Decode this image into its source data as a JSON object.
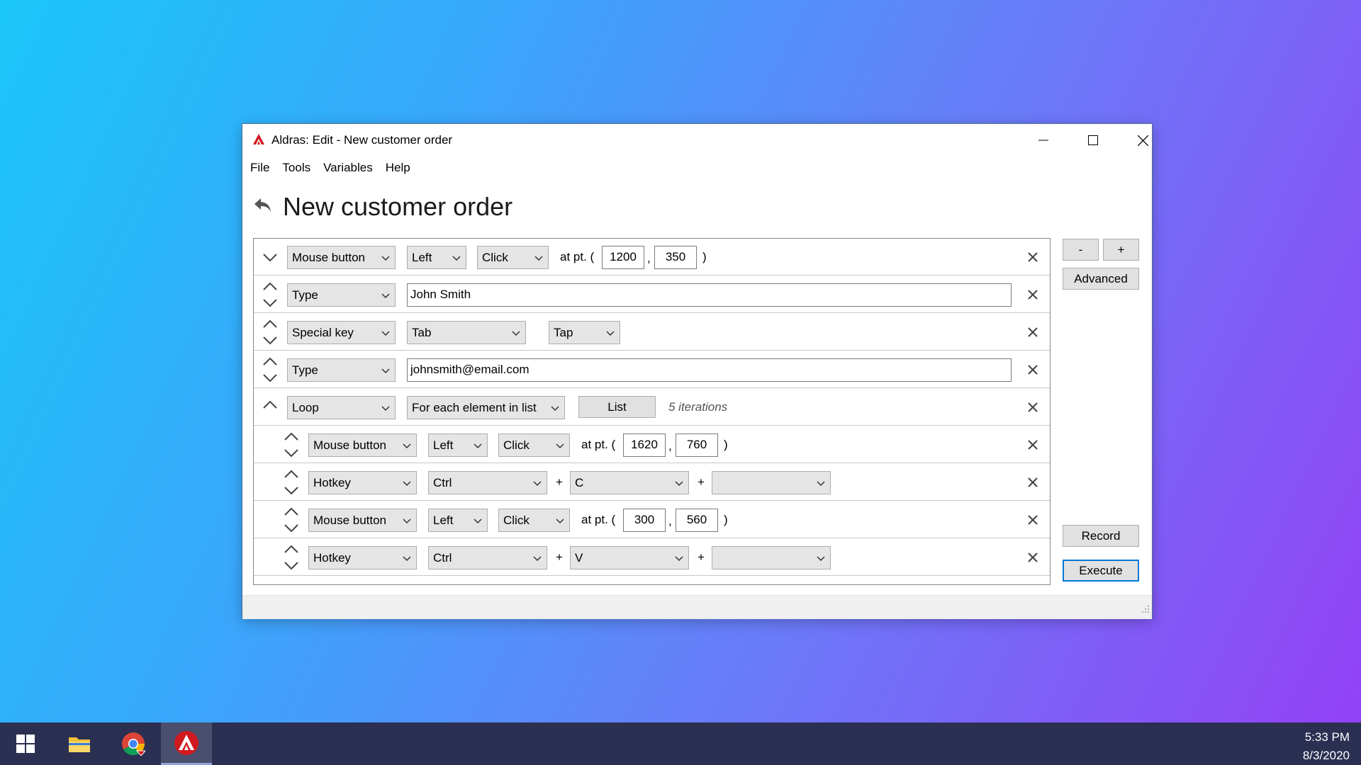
{
  "window": {
    "title": "Aldras: Edit - New customer order",
    "menu": [
      "File",
      "Tools",
      "Variables",
      "Help"
    ],
    "heading": "New customer order"
  },
  "rows": [
    {
      "kind": "Mouse button",
      "button": "Left",
      "action": "Click",
      "at_label": "at pt. (",
      "x": "1200",
      "y": "350",
      "comma": ",",
      "close": ")"
    },
    {
      "kind": "Type",
      "text": "John Smith"
    },
    {
      "kind": "Special key",
      "key": "Tab",
      "action": "Tap"
    },
    {
      "kind": "Type",
      "text": "johnsmith@email.com"
    },
    {
      "kind": "Loop",
      "mode": "For each element in list",
      "list_button": "List",
      "iterations": "5 iterations"
    },
    {
      "kind": "Mouse button",
      "button": "Left",
      "action": "Click",
      "at_label": "at pt. (",
      "x": "1620",
      "y": "760",
      "comma": ",",
      "close": ")"
    },
    {
      "kind": "Hotkey",
      "mod": "Ctrl",
      "plus": "+",
      "key": "C",
      "plus2": "+",
      "key2": ""
    },
    {
      "kind": "Mouse button",
      "button": "Left",
      "action": "Click",
      "at_label": "at pt. (",
      "x": "300",
      "y": "560",
      "comma": ",",
      "close": ")"
    },
    {
      "kind": "Hotkey",
      "mod": "Ctrl",
      "plus": "+",
      "key": "V",
      "plus2": "+",
      "key2": ""
    }
  ],
  "side": {
    "minus": "-",
    "plus": "+",
    "advanced": "Advanced",
    "record": "Record",
    "execute": "Execute"
  },
  "taskbar": {
    "time": "5:33 PM",
    "date": "8/3/2020"
  },
  "colors": {
    "accent": "#0078d7",
    "app_icon": "#d0191f",
    "taskbar": "#2b2f52"
  }
}
